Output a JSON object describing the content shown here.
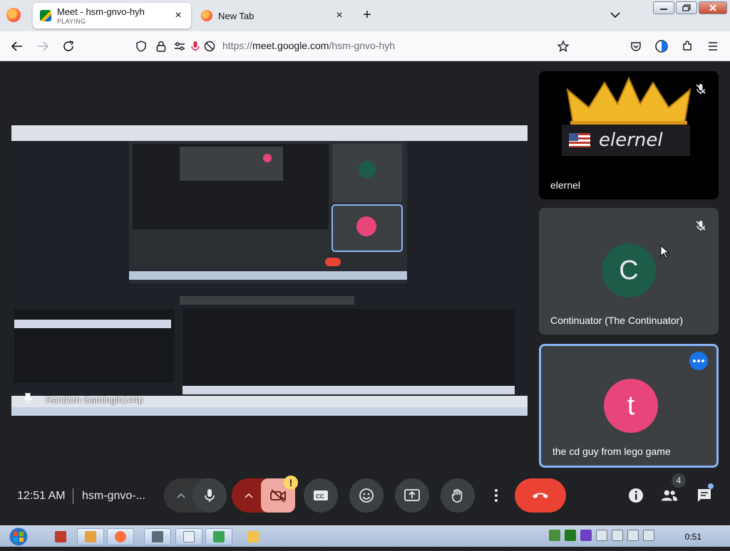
{
  "browser": {
    "tabs": [
      {
        "title": "Meet - hsm-gnvo-hyh",
        "status": "PLAYING"
      },
      {
        "title": "New Tab",
        "status": ""
      }
    ],
    "url_prefix": "https://",
    "url_host": "meet.google.com",
    "url_path": "/hsm-gnvo-hyh"
  },
  "meet": {
    "presenter_caption": "Random Gamingin144p",
    "participants": [
      {
        "name": "elernel",
        "initial": "",
        "muted": true
      },
      {
        "name": "Continuator (The Continuator)",
        "initial": "C",
        "muted": true
      },
      {
        "name": "the cd guy from lego game",
        "initial": "t",
        "muted": false
      }
    ],
    "crown_label": "elernel"
  },
  "controls": {
    "time": "12:51 AM",
    "meeting_code": "hsm-gnvo-...",
    "warning_glyph": "!",
    "people_count": "4"
  },
  "taskbar": {
    "clock": "0:51"
  },
  "colors": {
    "meet_bg": "#202124",
    "tile_bg": "#3c4043",
    "hangup_red": "#ea4335",
    "active_border": "#8ab4f8"
  }
}
